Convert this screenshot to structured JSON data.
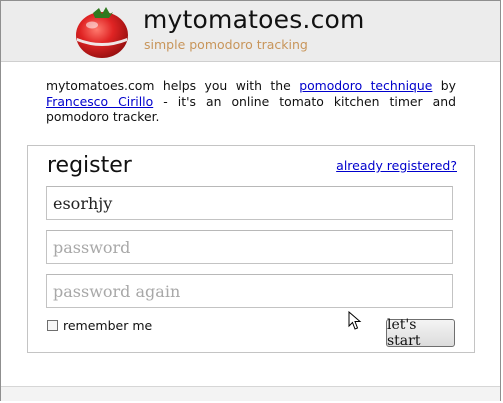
{
  "header": {
    "site_title": "mytomatoes.com",
    "tagline": "simple pomodoro tracking"
  },
  "intro": {
    "part1": "mytomatoes.com helps you with the ",
    "link1": "pomodoro technique",
    "part2": " by ",
    "link2": "Francesco Cirillo",
    "part3": " - it's an online tomato kitchen timer and pomodoro tracker."
  },
  "register": {
    "heading": "register",
    "already_link": "already registered?",
    "username_value": "esorhjy",
    "password_placeholder": "password",
    "password_again_placeholder": "password again",
    "remember_label": "remember me",
    "remember_checked": false,
    "submit_label": "let's start"
  },
  "colors": {
    "link": "#0000cc",
    "tagline": "#c8955a",
    "header_bg": "#ececec",
    "tomato": "#d81e1e"
  },
  "icons": [
    "tomato-timer-logo",
    "mouse-cursor-icon"
  ]
}
